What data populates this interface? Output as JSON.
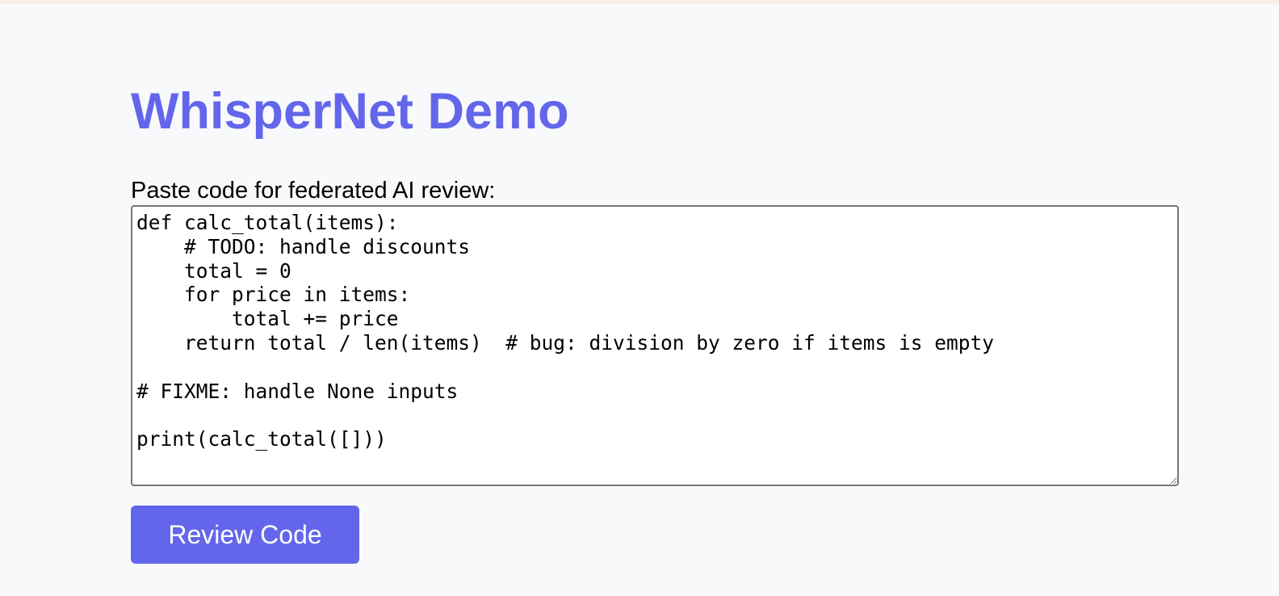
{
  "page": {
    "title": "WhisperNet Demo"
  },
  "form": {
    "label": "Paste code for federated AI review:",
    "code": "def calc_total(items):\n    # TODO: handle discounts\n    total = 0\n    for price in items:\n        total += price\n    return total / len(items)  # bug: division by zero if items is empty\n\n# FIXME: handle None inputs\n\nprint(calc_total([]))",
    "submit_label": "Review Code"
  },
  "colors": {
    "accent": "#6366eb",
    "background": "#f8f9fb",
    "top_border": "#fdeee4"
  }
}
